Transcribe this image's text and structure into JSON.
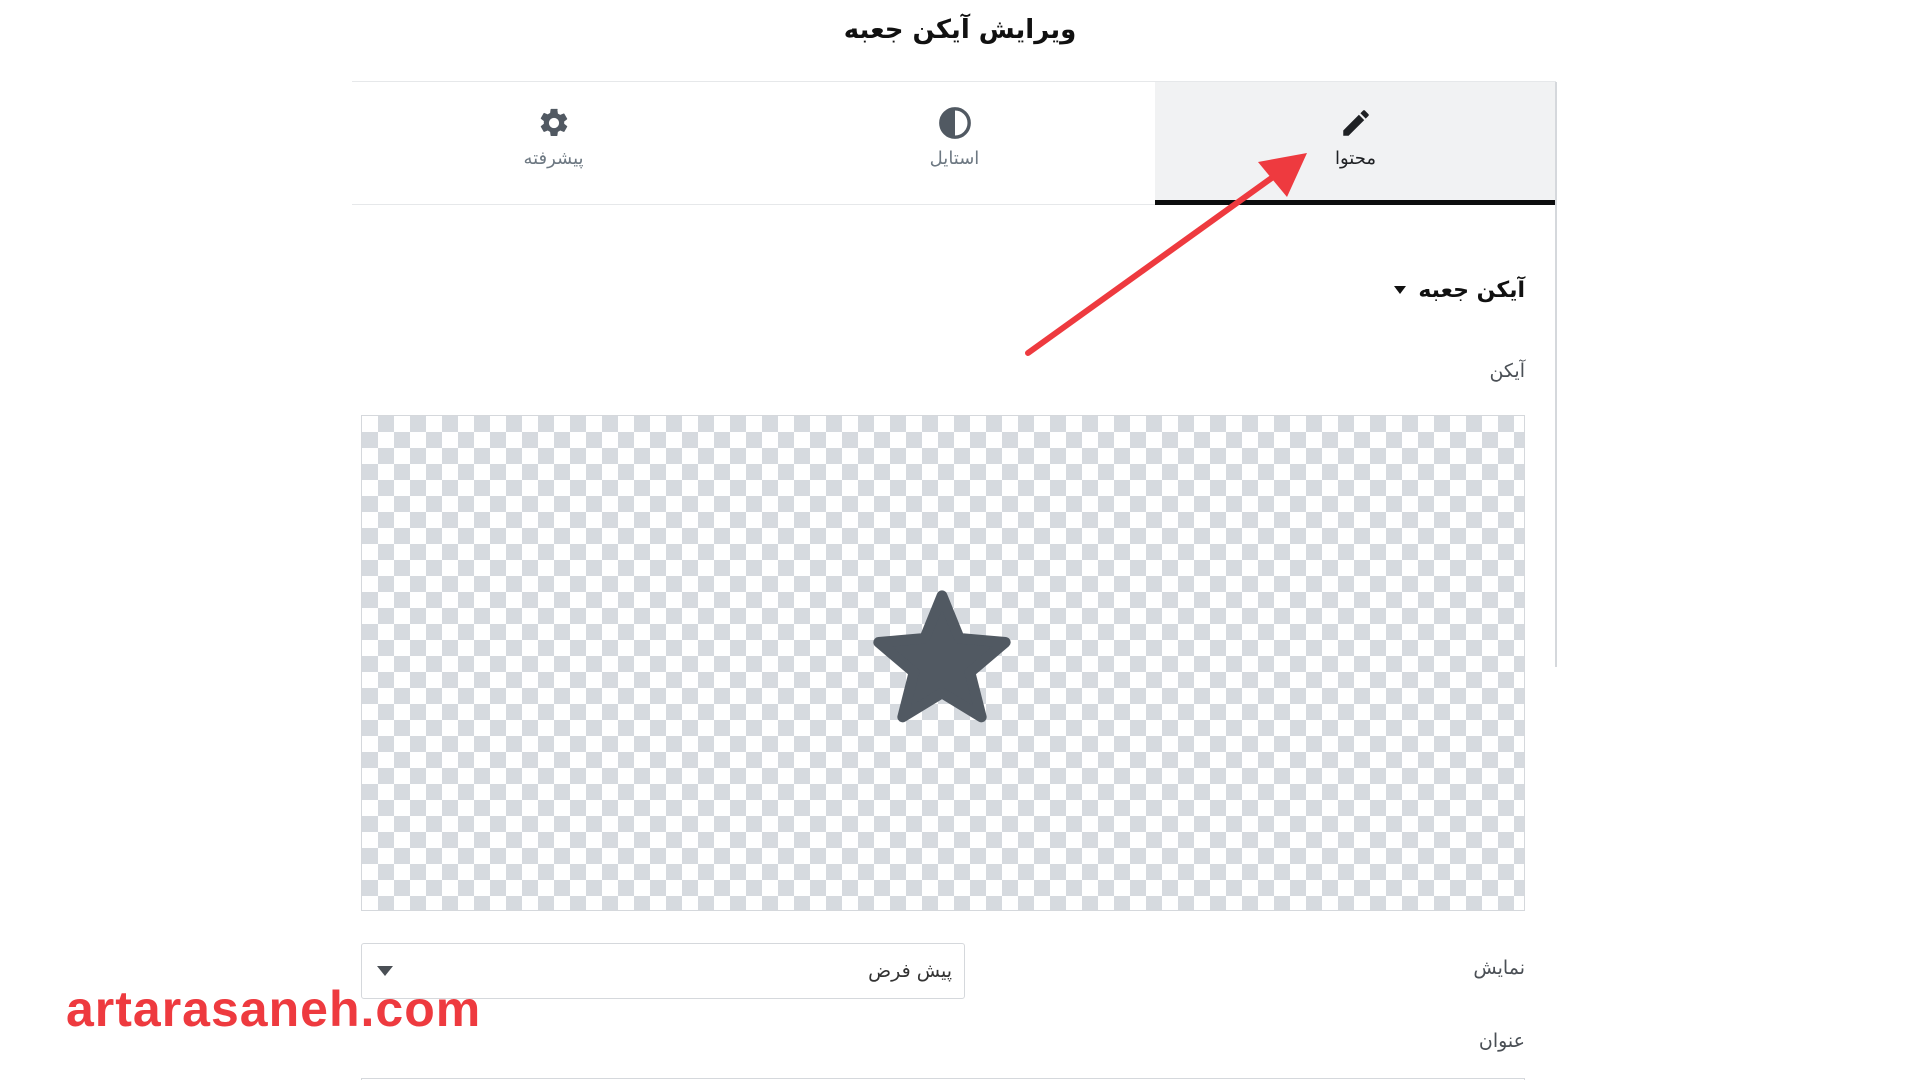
{
  "panel": {
    "title": "ویرایش آیکن جعبه"
  },
  "tabs": [
    {
      "key": "content",
      "label": "محتوا",
      "icon": "pencil-icon",
      "active": true
    },
    {
      "key": "style",
      "label": "استایل",
      "icon": "half-circle-icon",
      "active": false
    },
    {
      "key": "advanced",
      "label": "پیشرفته",
      "icon": "gear-icon",
      "active": false
    }
  ],
  "section": {
    "title": "آیکن جعبه",
    "icon": "caret-down-icon"
  },
  "fields": {
    "icon": {
      "label": "آیکن",
      "value_icon": "star-icon"
    },
    "view": {
      "label": "نمایش",
      "selected": "پیش فرض"
    },
    "title": {
      "label": "عنوان"
    }
  },
  "watermark": {
    "text": "artarasaneh.com"
  },
  "colors": {
    "annotation_arrow": "#ee3a3f",
    "watermark": "#ee3a3f",
    "active_tab_bg": "#f1f2f3",
    "active_tab_underline": "#0c0d0e",
    "star": "#515962"
  }
}
